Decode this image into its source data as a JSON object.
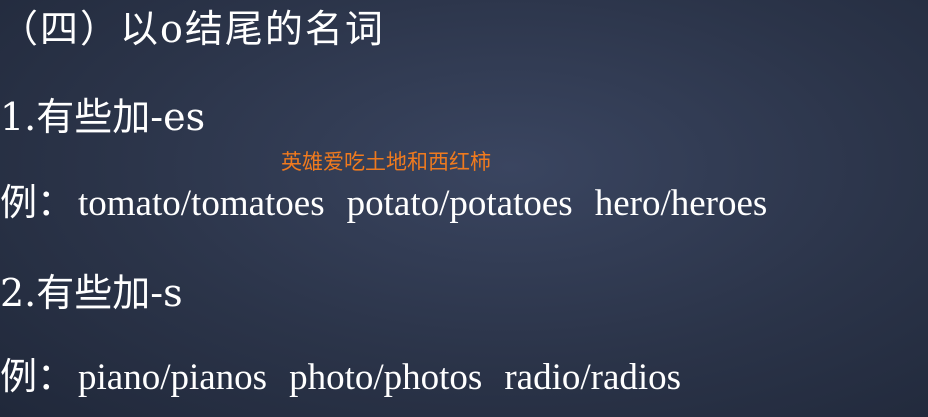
{
  "heading": "（四）以o结尾的名词",
  "section1": {
    "title": "1.有些加-es",
    "example_label": "例：",
    "examples": [
      "tomato/tomatoes",
      "potato/potatoes",
      "hero/heroes"
    ]
  },
  "overlay_caption": "英雄爱吃土地和西红柿",
  "section2": {
    "title": "2.有些加-s",
    "example_label": "例：",
    "examples": [
      "piano/pianos",
      "photo/photos",
      "radio/radios"
    ]
  },
  "colors": {
    "background": "#2b3449",
    "text": "#ffffff",
    "caption": "#f07a1e"
  }
}
